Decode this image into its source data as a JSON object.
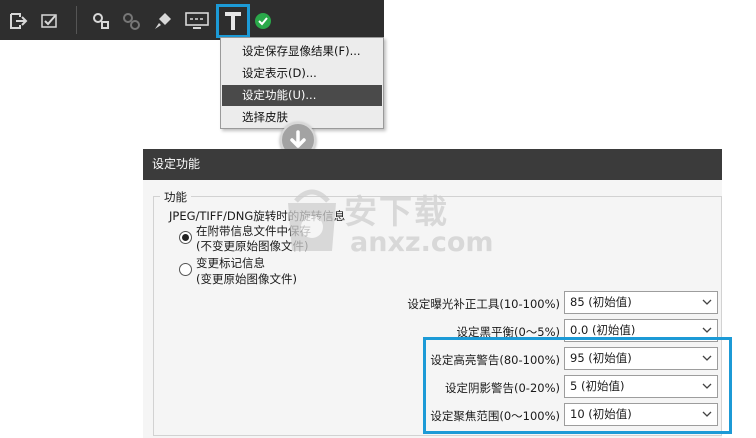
{
  "toolbar": {
    "buttons": [
      "export-icon",
      "checkbox-icon",
      "settings-icon",
      "disabled-settings-icon",
      "brush-icon",
      "display-icon",
      "function-hammer-icon",
      "check-circle-icon"
    ],
    "accent_color": "#1c9ad6",
    "check_color": "#2aa84a"
  },
  "menu": {
    "items": [
      {
        "label": "设定保存显像结果(F)..."
      },
      {
        "label": "设定表示(D)..."
      },
      {
        "label": "设定功能(U)..."
      },
      {
        "label": "选择皮肤"
      }
    ],
    "active_index": 2
  },
  "dialog": {
    "title": "设定功能",
    "group_title": "功能",
    "rotation_label": "JPEG/TIFF/DNG旋转时的旋转信息",
    "options": [
      {
        "line1": "在附带信息文件中保存",
        "line2": "(不变更原始图像文件)",
        "checked": true
      },
      {
        "line1": "变更标记信息",
        "line2": "(变更原始图像文件)",
        "checked": false
      }
    ],
    "settings": [
      {
        "label": "设定曝光补正工具(10-100%)",
        "value": "85 (初始值)"
      },
      {
        "label": "设定黑平衡(0～5%)",
        "value": "0.0 (初始值)"
      },
      {
        "label": "设定高亮警告(80-100%)",
        "value": "95 (初始值)"
      },
      {
        "label": "设定阴影警告(0-20%)",
        "value": "5 (初始值)"
      },
      {
        "label": "设定聚焦范围(0～100%)",
        "value": "10 (初始值)"
      }
    ]
  },
  "watermark": {
    "cn": "安下载",
    "en": "anxz.com"
  }
}
